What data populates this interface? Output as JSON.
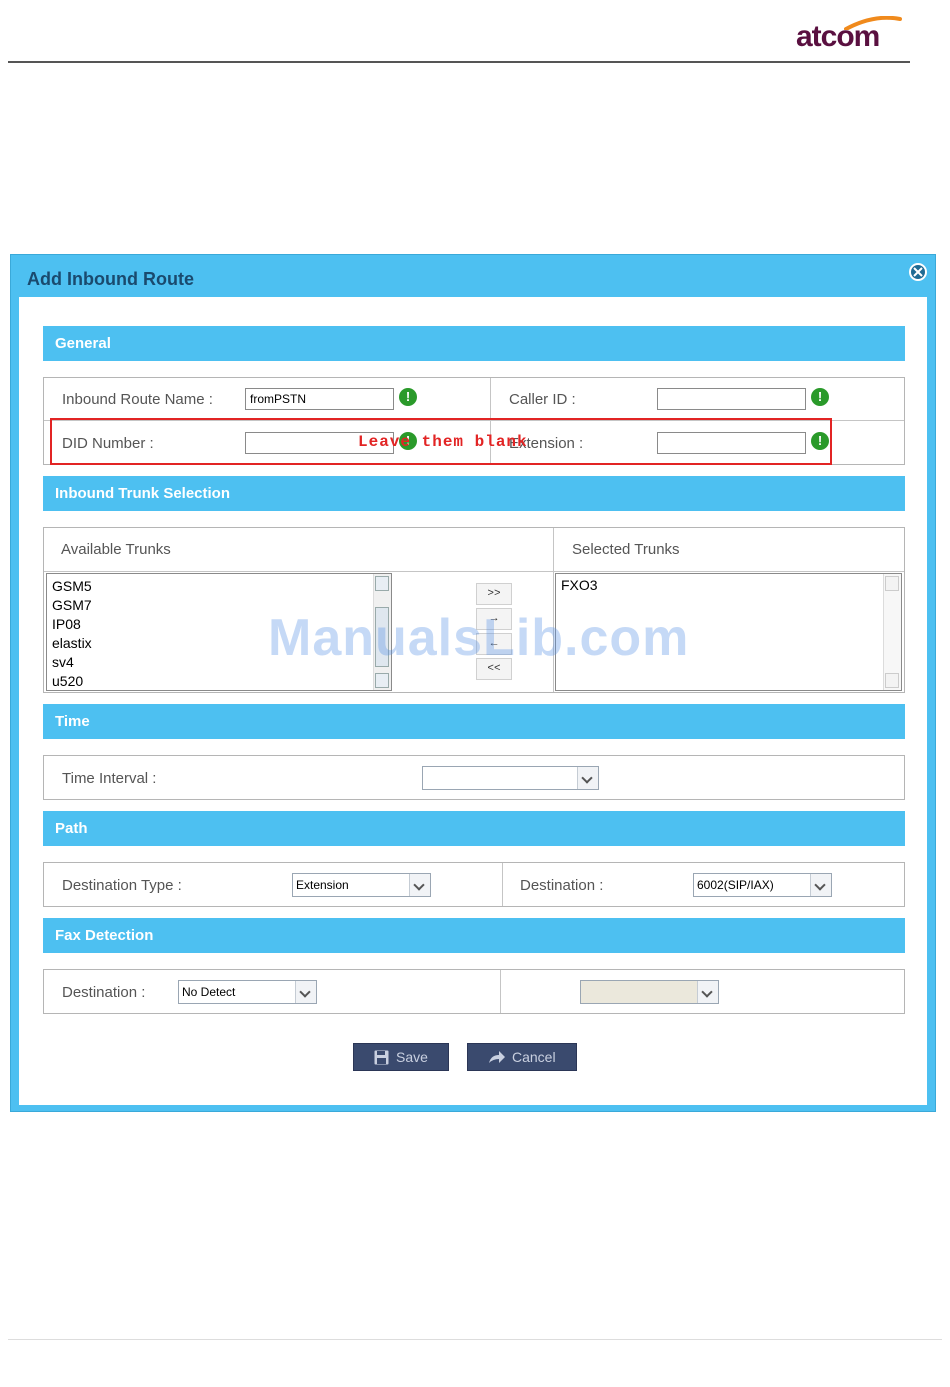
{
  "page_header": {
    "logo_text": "atcom"
  },
  "dialog": {
    "title": "Add Inbound Route",
    "sections": {
      "general": "General",
      "trunks": "Inbound Trunk Selection",
      "time": "Time",
      "path": "Path",
      "fax": "Fax Detection"
    },
    "general": {
      "route_name_label": "Inbound Route Name :",
      "route_name_value": "fromPSTN",
      "caller_id_label": "Caller ID :",
      "caller_id_value": "",
      "did_label": "DID Number :",
      "did_value": "",
      "extension_label": "Extension :",
      "extension_value": ""
    },
    "trunks": {
      "available_label": "Available Trunks",
      "selected_label": "Selected Trunks",
      "available": [
        "GSM5",
        "GSM7",
        "IP08",
        "elastix",
        "sv4",
        "u520"
      ],
      "selected": [
        "FXO3"
      ],
      "buttons": {
        "add_all": ">>",
        "add": "→",
        "remove": "←",
        "remove_all": "<<"
      }
    },
    "time": {
      "interval_label": "Time Interval :",
      "interval_value": ""
    },
    "path": {
      "dest_type_label": "Destination Type :",
      "dest_type_value": "Extension",
      "destination_label": "Destination :",
      "destination_value": "6002(SIP/IAX)"
    },
    "fax": {
      "destination_label": "Destination :",
      "destination_value": "No Detect",
      "secondary_value": ""
    },
    "actions": {
      "save": "Save",
      "cancel": "Cancel"
    }
  },
  "annotation": {
    "text": "Leave them blank"
  },
  "watermark": "ManualsLib.com",
  "colors": {
    "bar": "#4dc0f1",
    "title": "#1a4a6e",
    "annotation": "#e22424",
    "button": "#3a4a6e",
    "ok_icon": "#2a9a2a"
  }
}
